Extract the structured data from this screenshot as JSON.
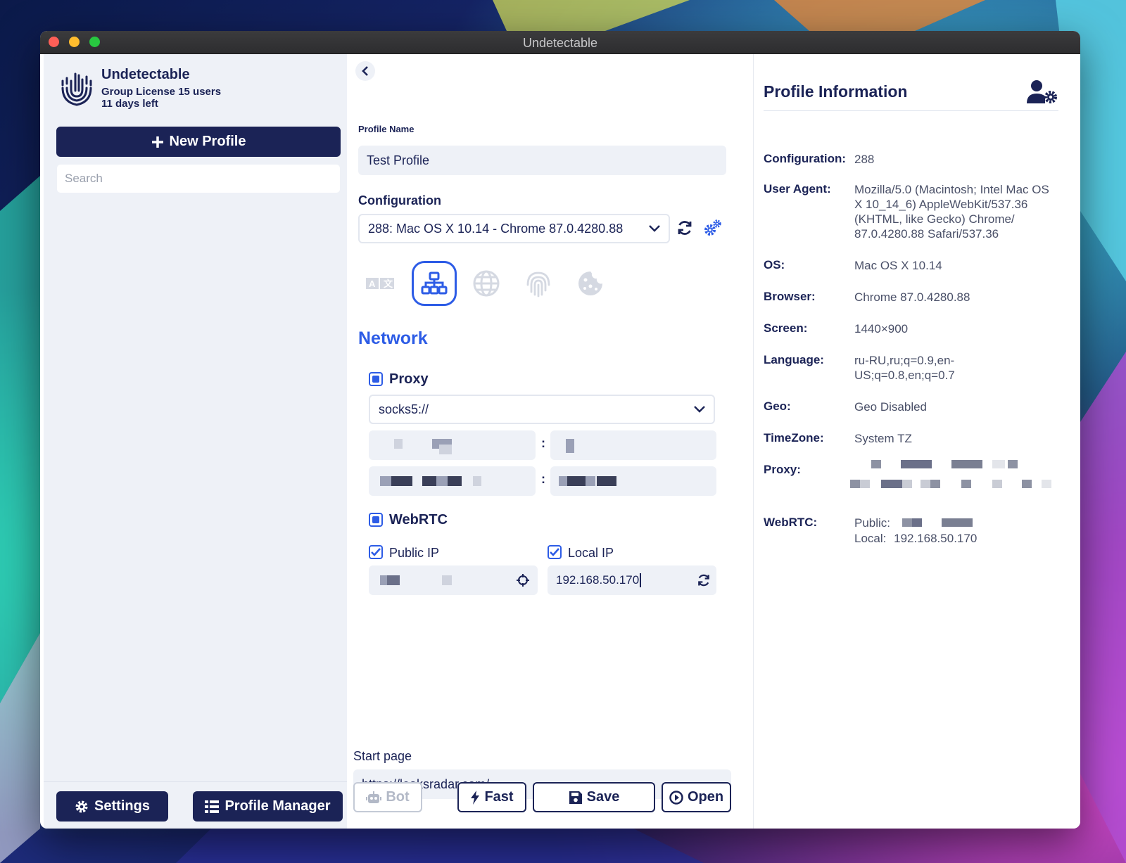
{
  "window": {
    "title": "Undetectable"
  },
  "sidebar": {
    "app_name": "Undetectable",
    "license": "Group License 15 users",
    "days_left": "11 days left",
    "new_profile_label": "New Profile",
    "search_placeholder": "Search",
    "settings_label": "Settings",
    "profile_manager_label": "Profile Manager"
  },
  "editor": {
    "profile_name_label": "Profile Name",
    "profile_name_value": "Test Profile",
    "configuration_label": "Configuration",
    "configuration_value": "288: Mac OS X 10.14 - Chrome 87.0.4280.88",
    "tabs": [
      {
        "name": "language-tab-icon",
        "active": false
      },
      {
        "name": "network-tab-icon",
        "active": true
      },
      {
        "name": "globe-tab-icon",
        "active": false
      },
      {
        "name": "fingerprint-tab-icon",
        "active": false
      },
      {
        "name": "cookie-tab-icon",
        "active": false
      }
    ],
    "section_title": "Network",
    "proxy": {
      "label": "Proxy",
      "checked": true,
      "protocol": "socks5://",
      "colon": ":"
    },
    "webrtc": {
      "label": "WebRTC",
      "checked": true,
      "public_ip_label": "Public IP",
      "public_ip_checked": true,
      "local_ip_label": "Local IP",
      "local_ip_checked": true,
      "local_ip_value": "192.168.50.170"
    },
    "start_page_label": "Start page",
    "start_page_value": "https://leaksradar.com/",
    "buttons": {
      "bot": "Bot",
      "fast": "Fast",
      "save": "Save",
      "open": "Open"
    },
    "accent_color": "#2d5ce6",
    "brand_color": "#1b2356"
  },
  "info": {
    "title": "Profile Information",
    "rows": {
      "configuration": {
        "key": "Configuration:",
        "value": "288"
      },
      "user_agent": {
        "key": "User Agent:",
        "value": "Mozilla/5.0 (Macintosh; Intel Mac OS X 10_14_6) AppleWebKit/537.36 (KHTML, like Gecko) Chrome/ 87.0.4280.88 Safari/537.36"
      },
      "os": {
        "key": "OS:",
        "value": "Mac OS X 10.14"
      },
      "browser": {
        "key": "Browser:",
        "value": "Chrome 87.0.4280.88"
      },
      "screen": {
        "key": "Screen:",
        "value": "1440×900"
      },
      "language": {
        "key": "Language:",
        "value": "ru-RU,ru;q=0.9,en-US;q=0.8,en;q=0.7"
      },
      "geo": {
        "key": "Geo:",
        "value": "Geo Disabled"
      },
      "timezone": {
        "key": "TimeZone:",
        "value": "System TZ"
      },
      "proxy": {
        "key": "Proxy:"
      },
      "webrtc": {
        "key": "WebRTC:",
        "public_label": "Public:",
        "local_label": "Local:",
        "local_value": "192.168.50.170"
      }
    }
  }
}
